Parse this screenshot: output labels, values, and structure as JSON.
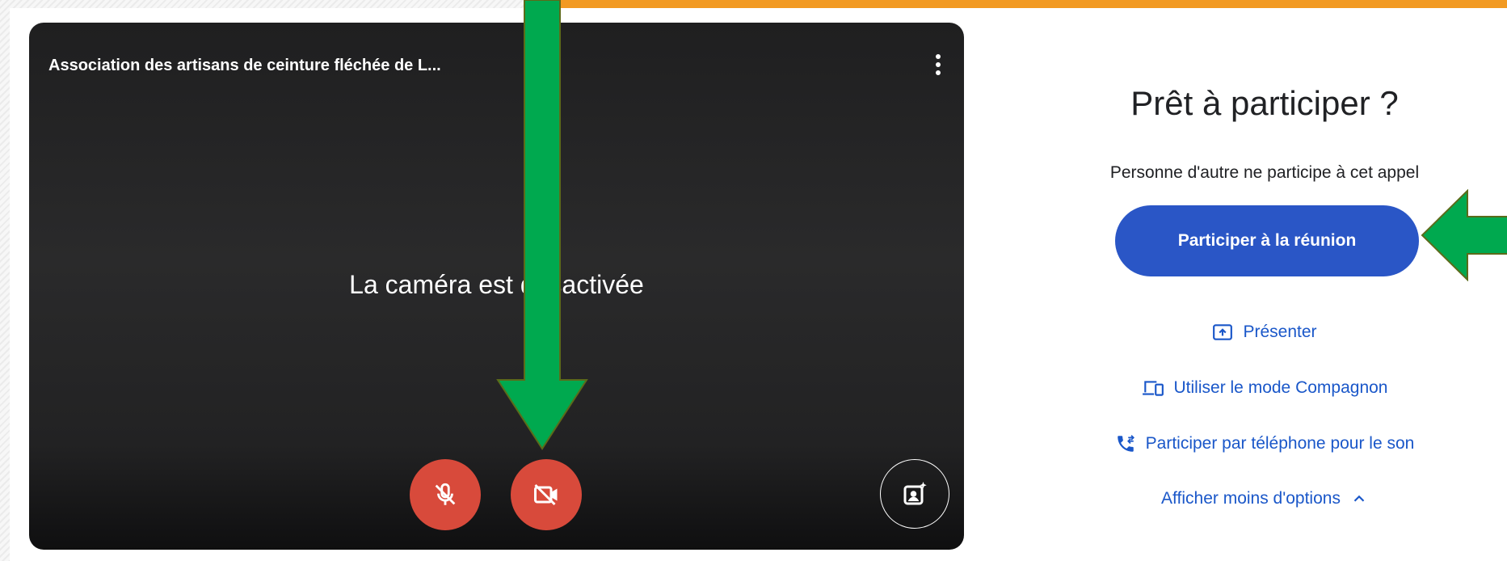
{
  "preview": {
    "meeting_title": "Association des artisans de ceinture fléchée de L...",
    "camera_status": "La caméra est désactivée",
    "more_icon": "more-vert-icon",
    "mic_icon": "mic-off-icon",
    "camera_icon": "videocam-off-icon",
    "effects_icon": "visual-effects-icon",
    "mic_color": "#d84a3b"
  },
  "panel": {
    "title": "Prêt à participer ?",
    "status": "Personne d'autre ne participe à cet appel",
    "join_label": "Participer à la réunion",
    "join_color": "#2a56c6",
    "link_color": "#1a57c9",
    "options": {
      "present": "Présenter",
      "companion": "Utiliser le mode Compagnon",
      "phone": "Participer par téléphone pour le son",
      "less": "Afficher moins d'options"
    }
  },
  "annotations": {
    "arrow_color": "#00a94f",
    "top_band_color": "#f29a22"
  }
}
